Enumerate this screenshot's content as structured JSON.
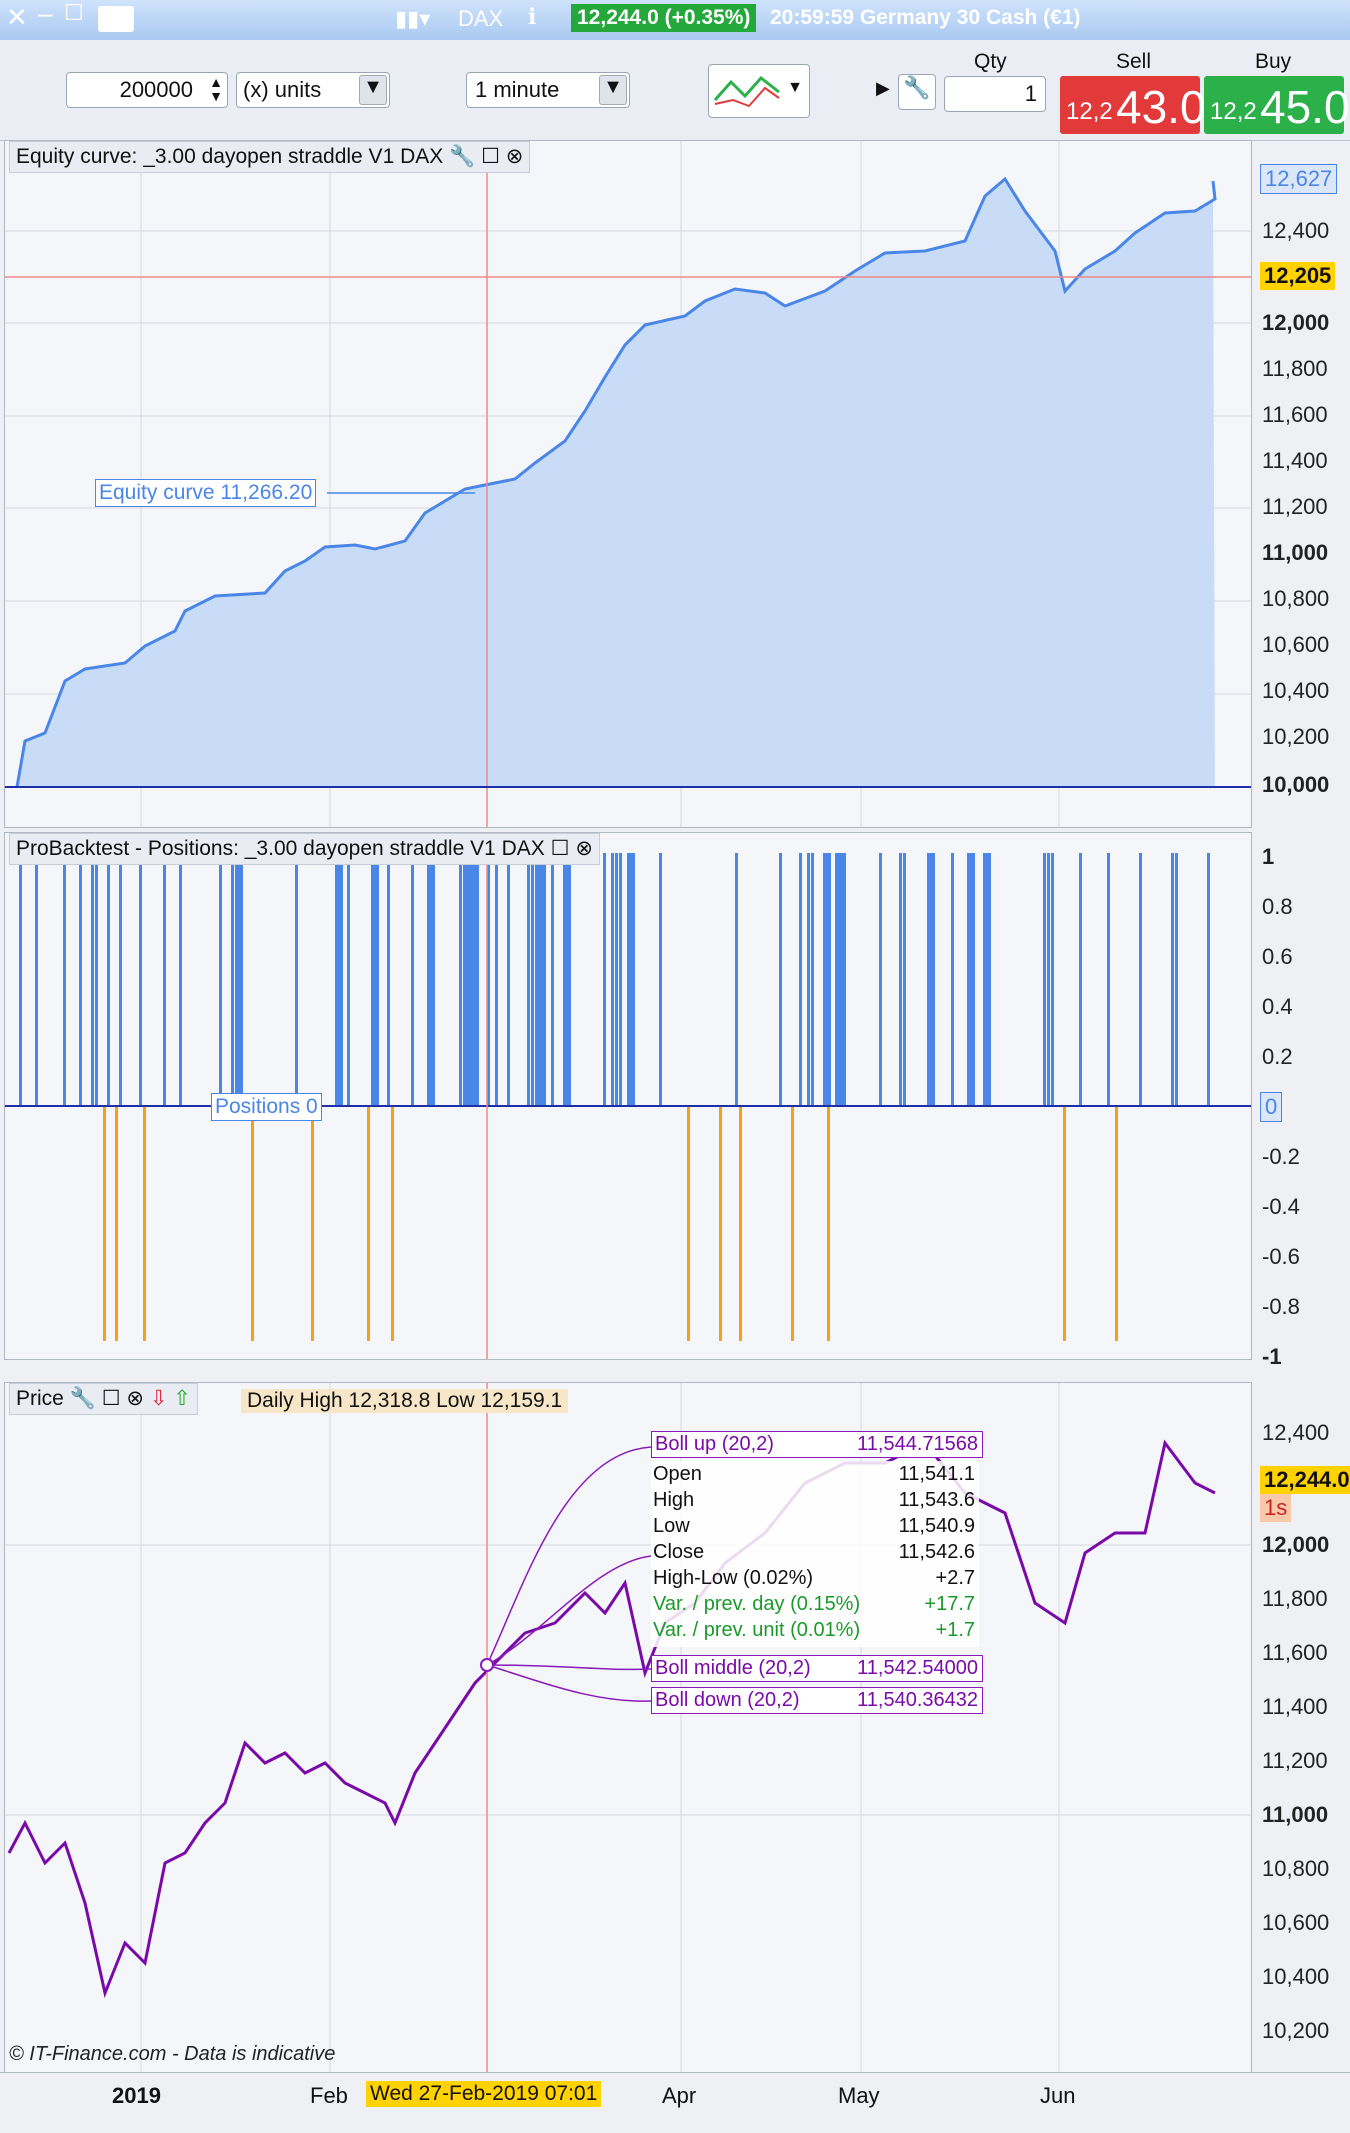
{
  "window": {
    "symbol": "DAX",
    "price_change": "12,244.0 (+0.35%)",
    "time_and_name": "20:59:59 Germany 30 Cash (€1)"
  },
  "toolbar": {
    "amount": "200000",
    "units": "(x) units",
    "timeframe": "1 minute",
    "qty_label": "Qty",
    "qty_value": "1",
    "sell_label": "Sell",
    "sell_prefix": "12,2",
    "sell_big": "43.0",
    "buy_label": "Buy",
    "buy_prefix": "12,2",
    "buy_big": "45.0"
  },
  "equity_panel": {
    "title": "Equity curve: _3.00 dayopen straddle V1 DAX",
    "cursor_label": "Equity curve  11,266.20",
    "last_value": "12,627",
    "cursor_value": "12,205",
    "ticks": [
      "12,400",
      "12,000",
      "11,800",
      "11,600",
      "11,400",
      "11,200",
      "11,000",
      "10,800",
      "10,600",
      "10,400",
      "10,200",
      "10,000"
    ]
  },
  "positions_panel": {
    "title": "ProBacktest - Positions: _3.00 dayopen straddle V1 DAX",
    "cursor_label": "Positions  0",
    "zero_badge": "0",
    "ticks": [
      "1",
      "0.8",
      "0.6",
      "0.4",
      "0.2",
      "-0.2",
      "-0.4",
      "-0.6",
      "-0.8",
      "-1"
    ]
  },
  "price_panel": {
    "title": "Price",
    "daily_text": "Daily High 12,318.8  Low 12,159.1",
    "last_value": "12,244.0",
    "countdown": "1s",
    "ticks": [
      "12,400",
      "12,000",
      "11,800",
      "11,600",
      "11,400",
      "11,200",
      "11,000",
      "10,800",
      "10,600",
      "10,400",
      "10,200"
    ],
    "copyright": "© IT-Finance.com - Data is indicative"
  },
  "tooltip": {
    "boll_up_label": "Boll up (20,2)",
    "boll_up_value": "11,544.71568",
    "open_label": "Open",
    "open_value": "11,541.1",
    "high_label": "High",
    "high_value": "11,543.6",
    "low_label": "Low",
    "low_value": "11,540.9",
    "close_label": "Close",
    "close_value": "11,542.6",
    "hl_label": "High-Low (0.02%)",
    "hl_value": "+2.7",
    "vpd_label": "Var. / prev. day (0.15%)",
    "vpd_value": "+17.7",
    "vpu_label": "Var. / prev. unit (0.01%)",
    "vpu_value": "+1.7",
    "boll_mid_label": "Boll middle (20,2)",
    "boll_mid_value": "11,542.54000",
    "boll_down_label": "Boll down (20,2)",
    "boll_down_value": "11,540.36432"
  },
  "xaxis": {
    "labels": [
      "2019",
      "Feb",
      "Apr",
      "May",
      "Jun"
    ],
    "cursor_date": "Wed 27-Feb-2019 07:01"
  },
  "colors": {
    "accent_blue": "#4a86e8",
    "orange": "#f6a01a",
    "purple": "#7a0aa8",
    "sell": "#e23a3a",
    "buy": "#2bb04a"
  }
}
